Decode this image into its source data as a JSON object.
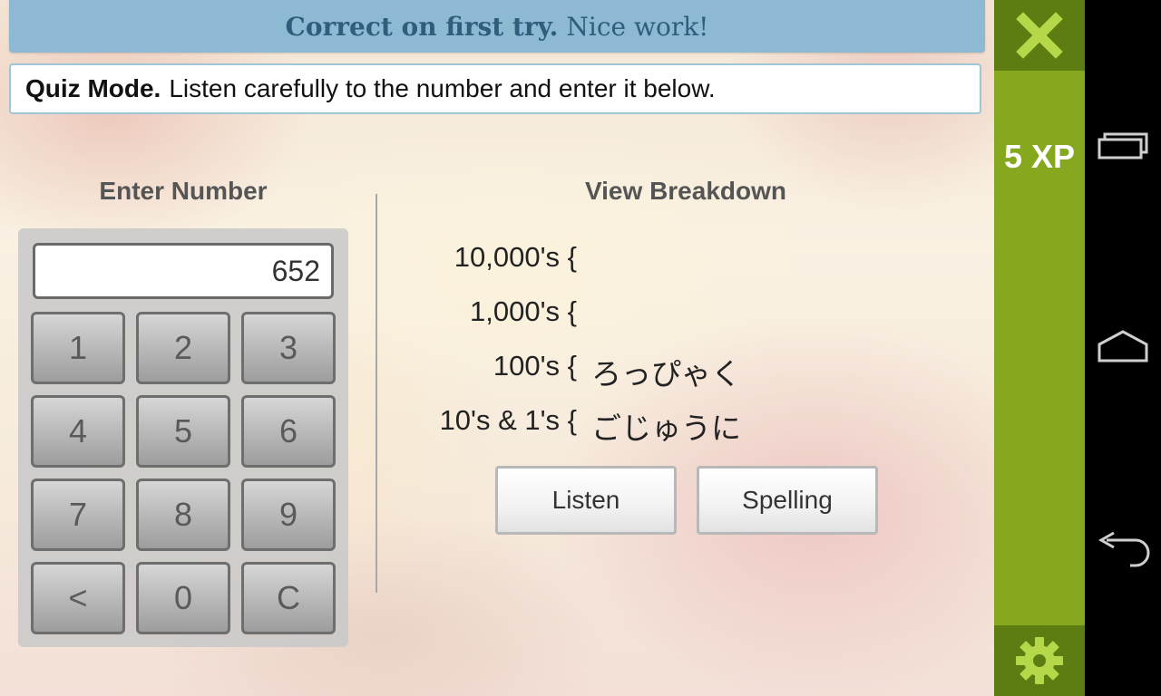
{
  "banner": {
    "result_bold": "Correct on first try.",
    "result_text": "Nice work!"
  },
  "mode": {
    "bold": "Quiz Mode.",
    "text": "Listen carefully to the number and enter it below."
  },
  "keypad": {
    "heading": "Enter Number",
    "display_value": "652",
    "keys": [
      "1",
      "2",
      "3",
      "4",
      "5",
      "6",
      "7",
      "8",
      "9",
      "<",
      "0",
      "C"
    ]
  },
  "breakdown": {
    "heading": "View Breakdown",
    "rows": [
      {
        "label": "10,000's {",
        "value": ""
      },
      {
        "label": "1,000's {",
        "value": ""
      },
      {
        "label": "100's {",
        "value": "ろっぴゃく"
      },
      {
        "label": "10's & 1's {",
        "value": "ごじゅうに"
      }
    ],
    "listen_label": "Listen",
    "spelling_label": "Spelling"
  },
  "side_panel": {
    "xp": "5 XP",
    "close_icon": "close-icon",
    "settings_icon": "gear-icon"
  },
  "nav_bar": {
    "icons": [
      "recent-apps-icon",
      "home-icon",
      "back-icon"
    ]
  },
  "colors": {
    "accent_green": "#85a81e",
    "dark_green": "#5d7c12",
    "banner_blue": "#8db9d3",
    "banner_text": "#2f5e7d"
  }
}
